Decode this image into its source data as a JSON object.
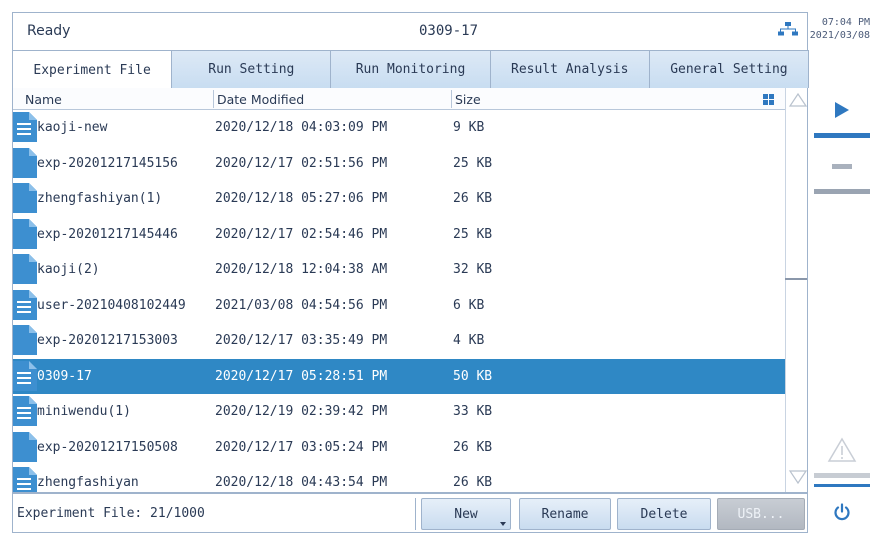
{
  "header": {
    "status": "Ready",
    "title": "0309-17",
    "time": "07:04 PM",
    "date": "2021/03/08"
  },
  "tabs": [
    {
      "label": "Experiment File",
      "active": true
    },
    {
      "label": "Run Setting",
      "active": false
    },
    {
      "label": "Run Monitoring",
      "active": false
    },
    {
      "label": "Result Analysis",
      "active": false
    },
    {
      "label": "General Setting",
      "active": false
    }
  ],
  "columns": {
    "name": "Name",
    "date": "Date Modified",
    "size": "Size"
  },
  "files": [
    {
      "name": "kaoji-new",
      "date": "2020/12/18 04:03:09 PM",
      "size": "9 KB",
      "icon": "document-lines-icon"
    },
    {
      "name": "exp-20201217145156",
      "date": "2020/12/17 02:51:56 PM",
      "size": "25 KB",
      "icon": "document-icon"
    },
    {
      "name": "zhengfashiyan(1)",
      "date": "2020/12/18 05:27:06 PM",
      "size": "26 KB",
      "icon": "document-icon"
    },
    {
      "name": "exp-20201217145446",
      "date": "2020/12/17 02:54:46 PM",
      "size": "25 KB",
      "icon": "document-icon"
    },
    {
      "name": "kaoji(2)",
      "date": "2020/12/18 12:04:38 AM",
      "size": "32 KB",
      "icon": "document-icon"
    },
    {
      "name": "user-20210408102449",
      "date": "2021/03/08 04:54:56 PM",
      "size": "6 KB",
      "icon": "document-lines-icon"
    },
    {
      "name": "exp-20201217153003",
      "date": "2020/12/17 03:35:49 PM",
      "size": "4 KB",
      "icon": "document-icon"
    },
    {
      "name": "0309-17",
      "date": "2020/12/17 05:28:51 PM",
      "size": "50 KB",
      "icon": "document-lines-icon",
      "selected": true
    },
    {
      "name": "miniwendu(1)",
      "date": "2020/12/19 02:39:42 PM",
      "size": "33 KB",
      "icon": "document-lines-icon"
    },
    {
      "name": "exp-20201217150508",
      "date": "2020/12/17 03:05:24 PM",
      "size": "26 KB",
      "icon": "document-icon"
    },
    {
      "name": "zhengfashiyan",
      "date": "2020/12/18 04:43:54 PM",
      "size": "26 KB",
      "icon": "document-lines-icon"
    }
  ],
  "footer": {
    "count": "Experiment File: 21/1000",
    "new_label": "New",
    "rename_label": "Rename",
    "delete_label": "Delete",
    "usb_label": "USB..."
  },
  "colors": {
    "accent": "#2f78c0",
    "selected_row": "#2f88c5",
    "tab_bg": "#c8ddf1",
    "border": "#9fb3cc"
  }
}
